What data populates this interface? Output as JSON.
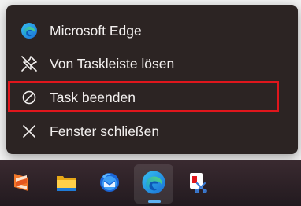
{
  "context_menu": {
    "items": [
      {
        "label": "Microsoft Edge",
        "icon": "edge-icon"
      },
      {
        "label": "Von Taskleiste lösen",
        "icon": "unpin-icon"
      },
      {
        "label": "Task beenden",
        "icon": "end-task-icon",
        "highlighted": true
      },
      {
        "label": "Fenster schließen",
        "icon": "close-icon"
      }
    ],
    "highlight_color": "#e0161c",
    "background": "#2c2423"
  },
  "taskbar": {
    "apps": [
      {
        "name": "sublime-text-icon"
      },
      {
        "name": "file-explorer-icon"
      },
      {
        "name": "thunderbird-icon"
      },
      {
        "name": "edge-icon",
        "active": true
      },
      {
        "name": "snipping-tool-icon"
      }
    ],
    "active_indicator_color": "#5fb2f2"
  }
}
